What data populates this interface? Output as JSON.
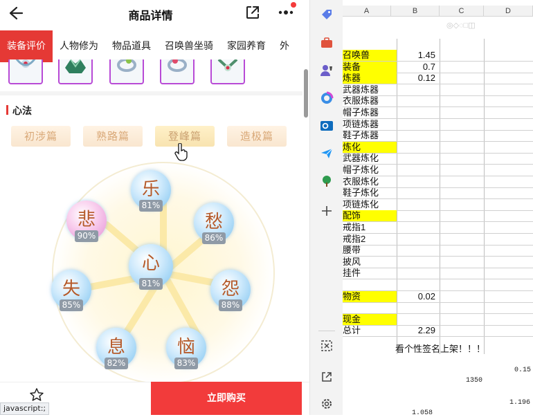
{
  "app": {
    "title": "商品详情",
    "tabs": [
      "装备评价",
      "人物修为",
      "物品道具",
      "召唤兽坐骑",
      "家园养育",
      "外"
    ],
    "section_title": "心法",
    "chapters": [
      "初涉篇",
      "熟路篇",
      "登峰篇",
      "造极篇"
    ],
    "emotions": [
      {
        "glyph": "乐",
        "pct": "81%"
      },
      {
        "glyph": "悲",
        "pct": "90%"
      },
      {
        "glyph": "愁",
        "pct": "86%"
      },
      {
        "glyph": "心",
        "pct": "81%"
      },
      {
        "glyph": "失",
        "pct": "85%"
      },
      {
        "glyph": "怨",
        "pct": "88%"
      },
      {
        "glyph": "息",
        "pct": "82%"
      },
      {
        "glyph": "恼",
        "pct": "83%"
      }
    ],
    "buy_label": "立即购买",
    "status_text": "javascript:;"
  },
  "sheet": {
    "columns": [
      "A",
      "B",
      "C",
      "D"
    ],
    "rows": [
      {
        "a": "召唤兽",
        "b": "1.45",
        "yellow": true
      },
      {
        "a": "装备",
        "b": "0.7",
        "yellow": true
      },
      {
        "a": "炼器",
        "b": "0.12",
        "yellow": true
      },
      {
        "a": "武器炼器",
        "b": ""
      },
      {
        "a": "衣服炼器",
        "b": ""
      },
      {
        "a": "帽子炼器",
        "b": ""
      },
      {
        "a": "项链炼器",
        "b": ""
      },
      {
        "a": "鞋子炼器",
        "b": ""
      },
      {
        "a": "炼化",
        "b": "",
        "yellow": true
      },
      {
        "a": "武器炼化",
        "b": ""
      },
      {
        "a": "帽子炼化",
        "b": ""
      },
      {
        "a": "衣服炼化",
        "b": ""
      },
      {
        "a": "鞋子炼化",
        "b": ""
      },
      {
        "a": "项链炼化",
        "b": ""
      },
      {
        "a": "配饰",
        "b": "",
        "yellow": true
      },
      {
        "a": "戒指1",
        "b": ""
      },
      {
        "a": "戒指2",
        "b": ""
      },
      {
        "a": "腰带",
        "b": ""
      },
      {
        "a": "披风",
        "b": ""
      },
      {
        "a": "挂件",
        "b": ""
      },
      {
        "a": "",
        "b": ""
      },
      {
        "a": "物资",
        "b": "0.02",
        "yellow": true
      },
      {
        "a": "",
        "b": ""
      },
      {
        "a": "现金",
        "b": "",
        "yellow": true
      },
      {
        "a": "总计",
        "b": "2.29"
      }
    ],
    "banner": "看个性签名上架！！！",
    "extra_values": [
      "0.15",
      "1350",
      "1.196",
      "1.058"
    ]
  }
}
